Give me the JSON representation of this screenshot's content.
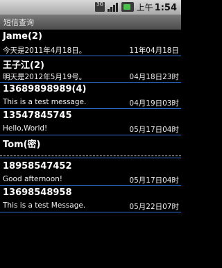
{
  "status_bar": {
    "network_label": "3G",
    "ampm": "上午",
    "time": "1:54",
    "icons": [
      "network-3g-icon",
      "signal-bars-icon",
      "battery-icon"
    ]
  },
  "title_bar": {
    "title": "短信查询"
  },
  "messages": [
    {
      "name": "Jame(2)",
      "body": "今天是2011年4月18日。",
      "date": "11年04月18日"
    },
    {
      "name": "王子江(2)",
      "body": "明天是2012年5月19号。",
      "date": "04月18日23时"
    },
    {
      "name": "13689898989(4)",
      "body": "This is a test message.",
      "date": "04月19日03时"
    },
    {
      "name": "13547845745",
      "body": "Hello,World!",
      "date": "05月17日04时"
    },
    {
      "name": "Tom(密)",
      "body": "",
      "date": ""
    },
    {
      "name": "18958547452",
      "body": "Good afternoon!",
      "date": "05月17日04时"
    },
    {
      "name": "13698548958",
      "body": "This is a test Message.",
      "date": "05月22日07时"
    }
  ],
  "colors": {
    "divider": "#2e6fd8",
    "background": "#000000",
    "status_bar": "#c4c4c4",
    "title_bar": "#5e5e5e"
  }
}
